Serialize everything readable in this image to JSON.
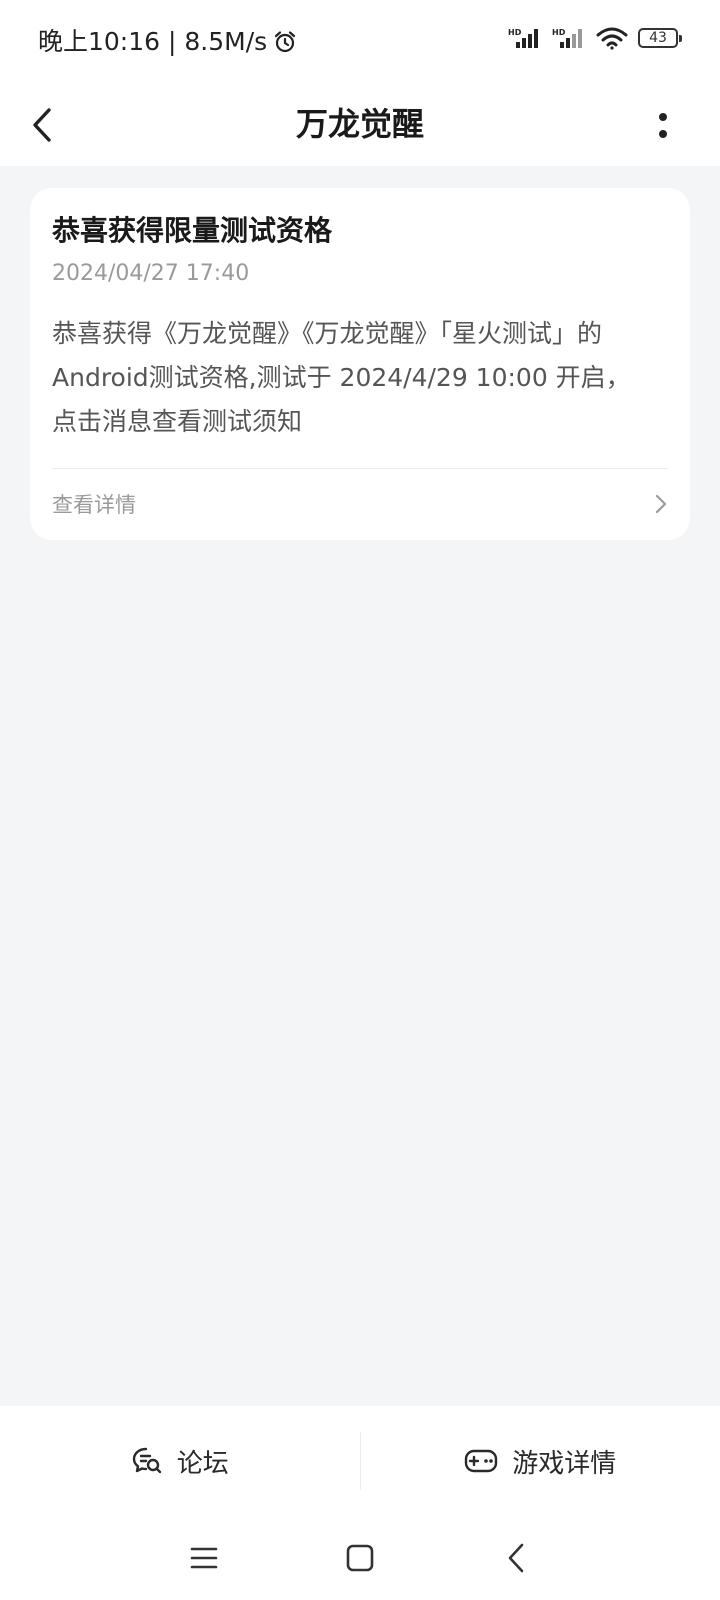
{
  "status_bar": {
    "time_speed": "晚上10:16 | 8.5M/s",
    "hd_label": "HD",
    "battery_level": "43",
    "icons": [
      "alarm-icon",
      "signal-icon",
      "signal-icon",
      "wifi-icon",
      "battery-icon"
    ]
  },
  "header": {
    "title": "万龙觉醒",
    "icons": [
      "back-arrow-icon",
      "more-vertical-icon"
    ]
  },
  "message": {
    "title": "恭喜获得限量测试资格",
    "time": "2024/04/27 17:40",
    "body": "恭喜获得《万龙觉醒》《万龙觉醒》「星火测试」的Android测试资格,测试于 2024/4/29 10:00 开启，点击消息查看测试须知",
    "link_label": "查看详情"
  },
  "bottom_bar": {
    "forum_label": "论坛",
    "game_details_label": "游戏详情"
  },
  "colors": {
    "background": "#f4f5f7",
    "card": "#ffffff",
    "primary_text": "#1a1a1a",
    "secondary_text": "#9a9a9a"
  }
}
